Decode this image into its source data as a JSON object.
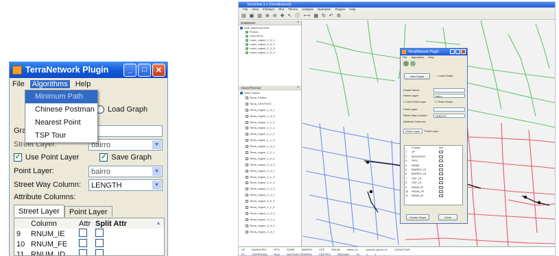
{
  "left_window": {
    "title": "TerraNetwork Plugin",
    "title_buttons": [
      "_",
      "□",
      "✕"
    ],
    "menu": [
      "File",
      "Algorithms",
      "Help"
    ],
    "algorithms_menu": [
      "Minimum Path",
      "Chinese Postman",
      "Nearest Point",
      "TSP Tour"
    ],
    "load_graph_label": "Load Graph",
    "graph_name_prefix": "Gra",
    "street_layer_label": "Street Layer:",
    "street_layer_value": "bairro",
    "use_point_layer_label": "Use Point Layer",
    "save_graph_label": "Save Graph",
    "point_layer_label": "Point Layer:",
    "point_layer_value": "bairro",
    "street_way_column_label": "Street Way Column:",
    "street_way_column_value": "LENGTH",
    "attribute_columns_label": "Attribute Columns:",
    "tabs": [
      "Street Layer",
      "Point Layer"
    ],
    "table_headers": [
      "Column",
      "Attr",
      "Split Attr"
    ],
    "table_rows": [
      {
        "num": "9",
        "column": "RNUM_IE"
      },
      {
        "num": "10",
        "column": "RNUM_FE"
      },
      {
        "num": "11",
        "column": "RNUM_ID"
      }
    ]
  },
  "right_app": {
    "title": "TerraView 3.x (TerraNetwork)",
    "menu": [
      "File",
      "View",
      "Infolayer",
      "Plot",
      "Theme",
      "Analysis",
      "Operation",
      "Plugins",
      "Help"
    ],
    "database_panel_title": "Databases",
    "database_root": "rede_itaperuna.mdb",
    "database_items": [
      "Pontos",
      "CENTROS",
      "Layer_region_1_0_1",
      "Layer_region_1_0_2",
      "Layer_region_1_0_3",
      "Layer_region_1_0_4"
    ],
    "views_panel_title": "Views/Themes",
    "view_root": "Vista_Dados",
    "view_items": [
      "Tema_Pontos",
      "Tema_CENTROS",
      "Tema_region_1_0_1",
      "Tema_region_1_0_2",
      "Tema_region_1_1_0",
      "Tema_region_1_1_1",
      "Tema_region_1_1_2",
      "Tema_region_1_1_3",
      "Tema_region_1_2_0",
      "Tema_region_1_2_1",
      "Tema_region_1_2_2",
      "Tema_region_2_0_0",
      "Tema_region_2_0_1",
      "Tema_region_2_1_0",
      "Tema_region_2_1_1",
      "Tema_region_2_2_0",
      "Tema_region_2_2_1",
      "Tema_region_3_0_0",
      "Tema_region_3_1_0",
      "Tema_region_3_2_0",
      "Tema_region_3_2_1",
      "Tema_region_3_3_0",
      "Tema_region_3_3_1"
    ],
    "plugin_dialog": {
      "title": "TerraNetwork Plugin",
      "menu": [
        "File",
        "Algorithms",
        "Help"
      ],
      "new_graph": "New Graph",
      "load_graph": "Load Graph",
      "graph_name": "Graph Name:",
      "street_layer": "Street Layer:",
      "street_layer_value": "bairro",
      "use_point_layer": "Use Point Layer",
      "save_graph": "Save Graph",
      "point_layer": "Point Layer:",
      "street_way_column": "Street Way Column:",
      "street_way_value": "LENGTH",
      "attribute_columns": "Attribute Columns:",
      "tabs": [
        "Street Layer",
        "Point Layer"
      ],
      "column_header": "Column",
      "attr_header": "Attr",
      "rows": [
        {
          "num": "1",
          "col": "UF"
        },
        {
          "num": "2",
          "col": "MUNICIPIO"
        },
        {
          "num": "3",
          "col": "TIPO"
        },
        {
          "num": "4",
          "col": "NOME"
        },
        {
          "num": "5",
          "col": "BAIRRO_LE"
        },
        {
          "num": "6",
          "col": "BAIRRO_LD"
        },
        {
          "num": "7",
          "col": "CEP_LE"
        },
        {
          "num": "8",
          "col": "CEP_LD"
        },
        {
          "num": "9",
          "col": "RNUM_IE"
        },
        {
          "num": "10",
          "col": "RNUM_FE"
        },
        {
          "num": "11",
          "col": "RNUM_ID"
        }
      ],
      "create_graph": "Create Graph",
      "close": "Close"
    },
    "table_headers": [
      "UF",
      "MUNICIPIO",
      "TIPO",
      "NOME",
      "BAIRRO",
      "CEP",
      "RNUM",
      "object_id_",
      "pseudo_geom_id",
      "CARACCIAR"
    ],
    "table_row": [
      "RJ",
      "ITAPERUNA",
      "RUA",
      "ANTONIO PEREIRA",
      "CENTRO",
      "28300000",
      "10",
      "1",
      "1",
      "--"
    ]
  },
  "colors": {
    "street_green": "#63c26e",
    "street_blue": "#6f8fe6",
    "street_red": "#e6585f",
    "route_node": "#111111",
    "xp_title_blue": "#1258d8",
    "menu_highlight": "#316ac5"
  }
}
